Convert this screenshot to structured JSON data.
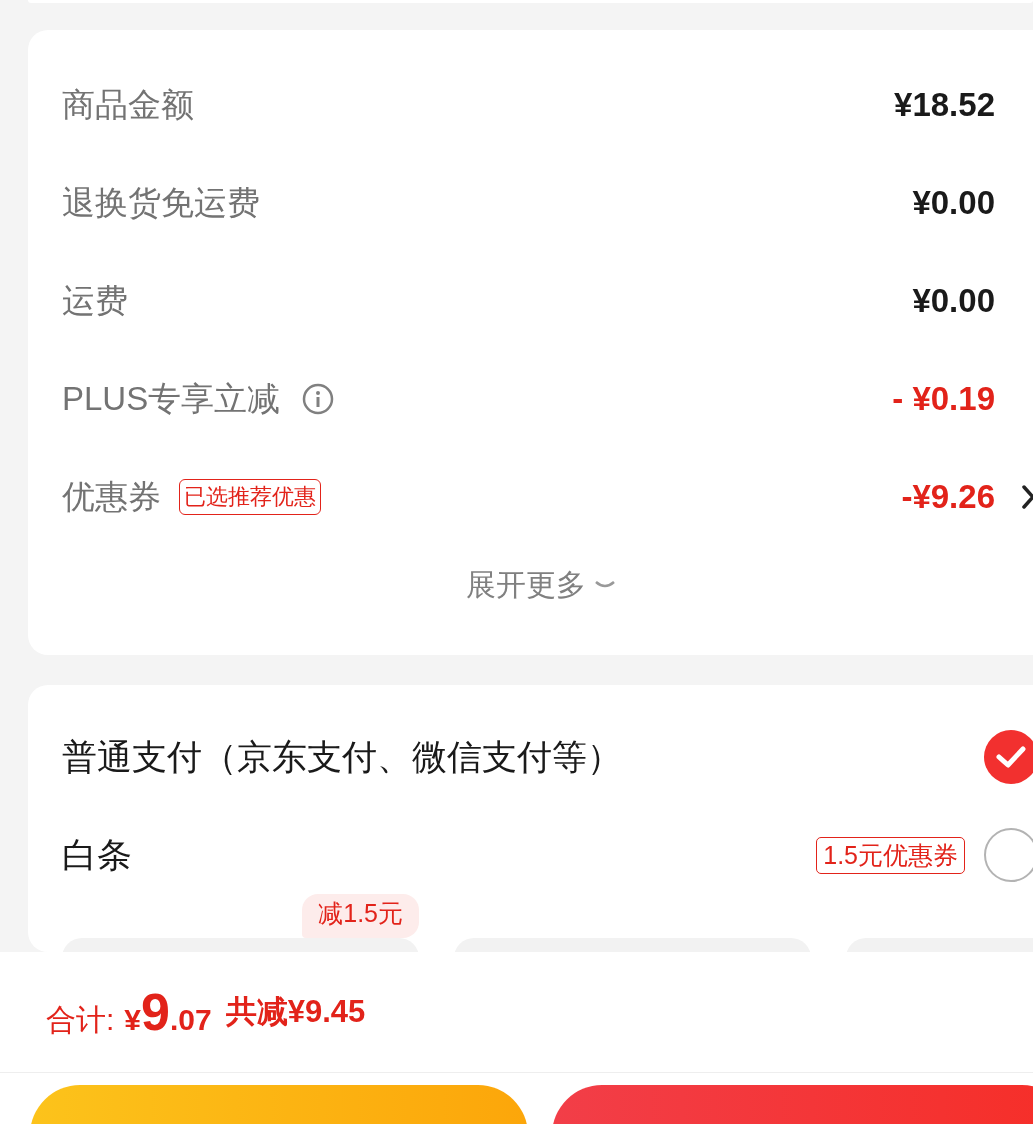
{
  "fees": [
    {
      "kind": "plain",
      "label": "商品金额",
      "value": "¥18.52"
    },
    {
      "kind": "plain",
      "label": "退换货免运费",
      "value": "¥0.00"
    },
    {
      "kind": "plain",
      "label": "运费",
      "value": "¥0.00"
    },
    {
      "kind": "discount",
      "label": "PLUS专享立减",
      "info": true,
      "value": "- ¥0.19"
    },
    {
      "kind": "discount",
      "label": "优惠券",
      "tag": "已选推荐优惠",
      "value": "-¥9.26",
      "link": true
    }
  ],
  "expand": {
    "label": "展开更多",
    "expanded": false
  },
  "payment": [
    {
      "label": "普通支付（京东支付、微信支付等）",
      "selected": true
    },
    {
      "label": "白条",
      "badge": "1.5元优惠券",
      "selected": false
    }
  ],
  "installment_cards": [
    {
      "kind": "card",
      "badge": "减1.5元"
    },
    {
      "kind": "card"
    },
    {
      "kind": "card"
    }
  ],
  "total": {
    "label": "合计:",
    "currency": "¥",
    "integer": "9",
    "decimals": ".07",
    "saving": "共减¥9.45"
  },
  "buttons": [
    {
      "kind": "secondary"
    },
    {
      "kind": "primary"
    }
  ]
}
